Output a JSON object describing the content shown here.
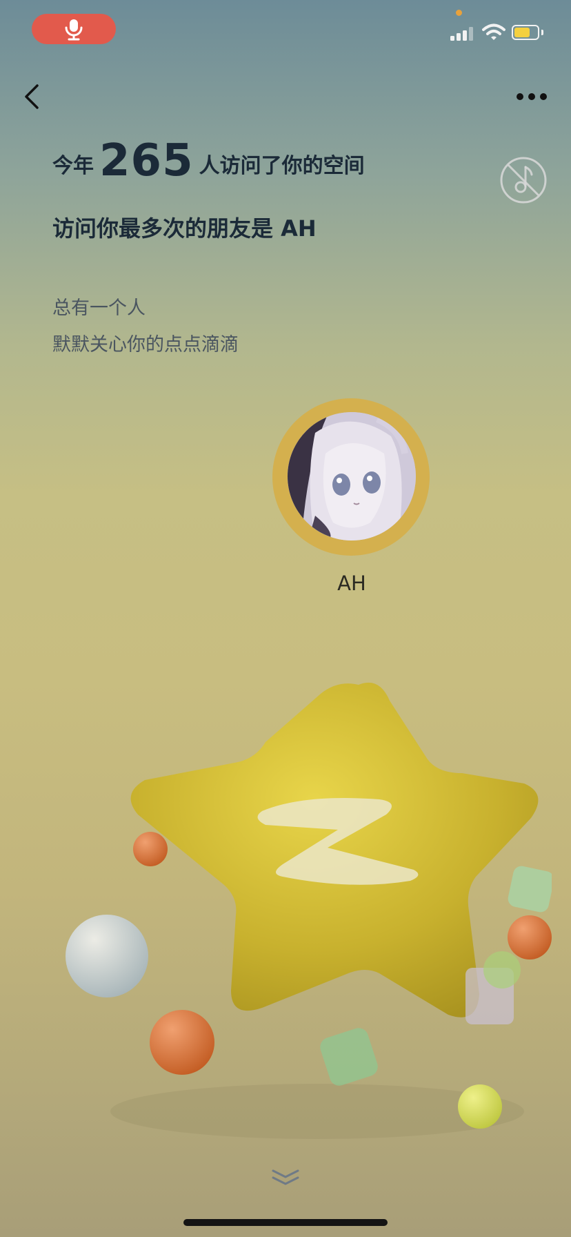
{
  "app": {
    "name": "QQ空间"
  },
  "status_bar": {
    "mic_active": true,
    "signal_bars": 3,
    "wifi": true,
    "battery_level": 0.65,
    "colors": {
      "mic": "#e25a4c",
      "battery": "#f4d03f",
      "privacy_dot": "#e8a23c"
    }
  },
  "nav": {
    "back_icon": "chevron-left-icon",
    "more_icon": "more-horizontal-icon",
    "mute_icon": "music-off-icon"
  },
  "summary": {
    "prefix": "今年",
    "visitor_count": "265",
    "suffix": "人访问了你的空间",
    "top_friend_line": "访问你最多次的朋友是 AH",
    "quote_line1": "总有一个人",
    "quote_line2": "默默关心你的点点滴滴"
  },
  "friend": {
    "name": "AH",
    "avatar_icon": "avatar-anime-girl"
  },
  "footer": {
    "scroll_hint_icon": "double-chevron-down-icon"
  },
  "colors": {
    "text_dark": "#1b2a38",
    "text_muted": "#4a5560",
    "ring": "#d4b04e"
  }
}
